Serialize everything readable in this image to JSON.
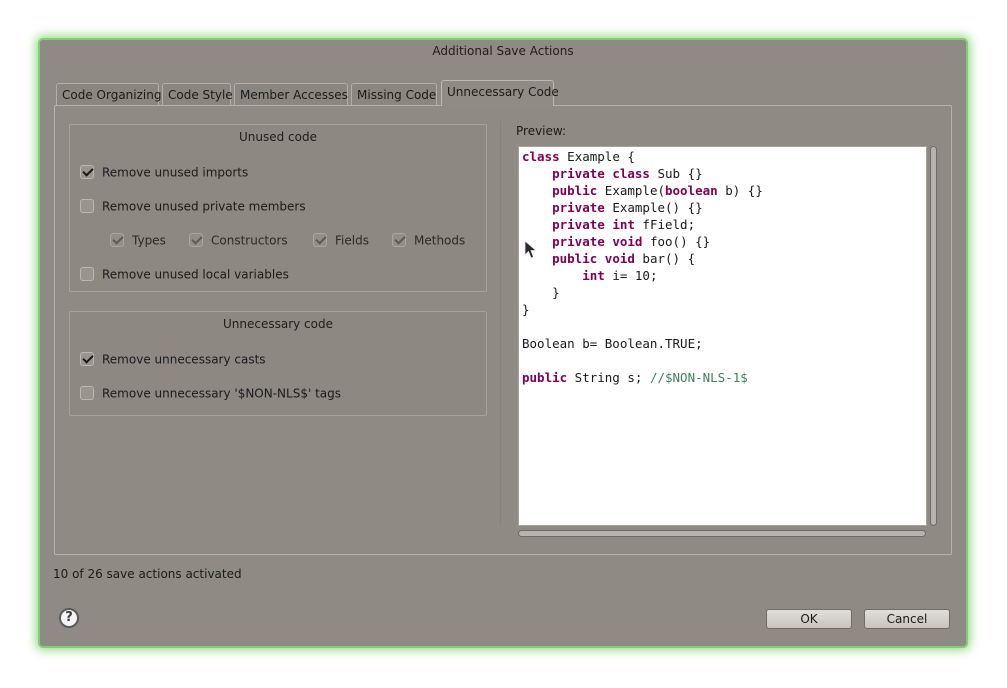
{
  "dialog": {
    "title": "Additional Save Actions"
  },
  "tabs": [
    {
      "label": "Code Organizing",
      "active": false
    },
    {
      "label": "Code Style",
      "active": false
    },
    {
      "label": "Member Accesses",
      "active": false
    },
    {
      "label": "Missing Code",
      "active": false
    },
    {
      "label": "Unnecessary Code",
      "active": true
    }
  ],
  "unused_code": {
    "title": "Unused code",
    "remove_imports": {
      "label": "Remove unused imports",
      "checked": true
    },
    "remove_private_members": {
      "label": "Remove unused private members",
      "checked": false
    },
    "types": {
      "label": "Types",
      "checked": true
    },
    "constructors": {
      "label": "Constructors",
      "checked": true
    },
    "fields": {
      "label": "Fields",
      "checked": true
    },
    "methods": {
      "label": "Methods",
      "checked": true
    },
    "remove_local_variables": {
      "label": "Remove unused local variables",
      "checked": false
    }
  },
  "unnecessary_code": {
    "title": "Unnecessary code",
    "remove_casts": {
      "label": "Remove unnecessary casts",
      "checked": true
    },
    "remove_nls_tags": {
      "label": "Remove unnecessary '$NON-NLS$' tags",
      "checked": false
    }
  },
  "preview": {
    "label": "Preview:",
    "code_lines": [
      "class Example {",
      "    private class Sub {}",
      "    public Example(boolean b) {}",
      "    private Example() {}",
      "    private int fField;",
      "    private void foo() {}",
      "    public void bar() {",
      "        int i= 10;",
      "    }",
      "}",
      "",
      "Boolean b= Boolean.TRUE;",
      "",
      "public String s; //$NON-NLS-1$"
    ]
  },
  "status": {
    "text": "10 of 26 save actions activated"
  },
  "buttons": {
    "ok": "OK",
    "cancel": "Cancel",
    "help_icon": "question-mark"
  },
  "colors": {
    "dialog_bg": "#8f8b84",
    "glow": "#7fcf6f",
    "keyword": "#7f0055",
    "comment": "#3f7f5f"
  }
}
